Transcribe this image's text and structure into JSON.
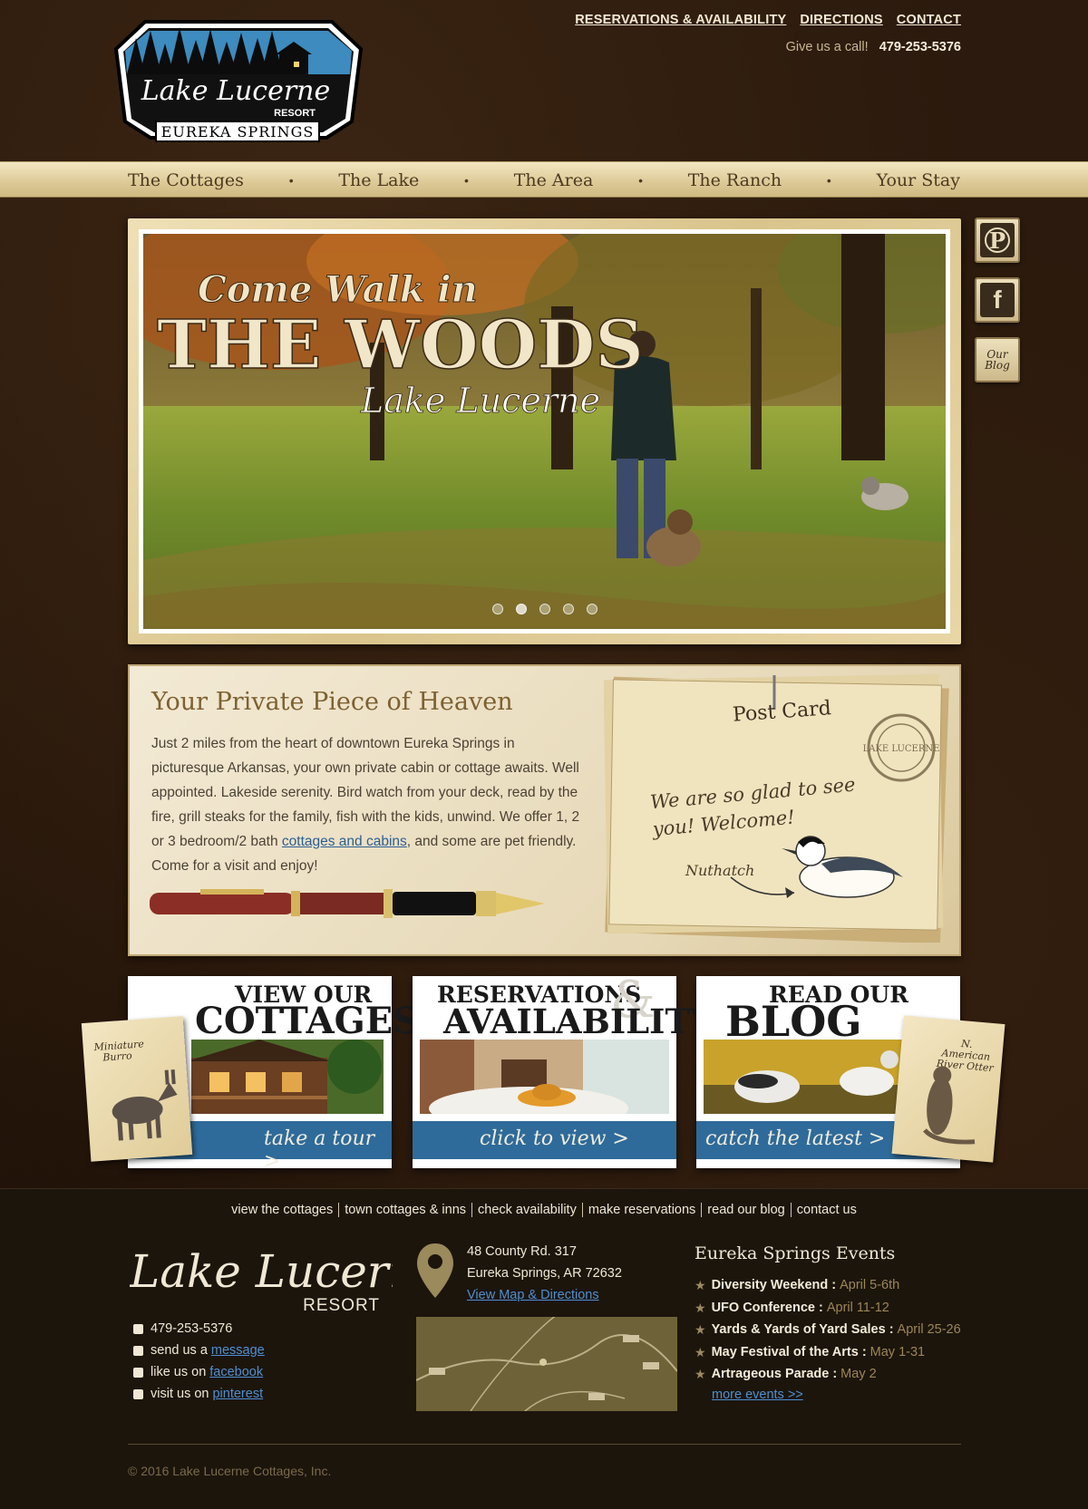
{
  "header": {
    "logo": {
      "line1": "Lake Lucerne",
      "line2": "RESORT",
      "line3": "EUREKA SPRINGS"
    },
    "top_links": [
      "RESERVATIONS & AVAILABILITY",
      "DIRECTIONS",
      "CONTACT"
    ],
    "call_label": "Give us a call!",
    "phone": "479-253-5376"
  },
  "nav": {
    "items": [
      "The Cottages",
      "The Lake",
      "The Area",
      "The Ranch",
      "Your Stay"
    ],
    "separator": "•"
  },
  "social": {
    "pinterest": "P",
    "facebook": "f",
    "blog": "Our Blog"
  },
  "hero": {
    "line1": "Come Walk in",
    "line2": "THE WOODS",
    "line3": "Lake Lucerne",
    "slides": 5,
    "active_slide": 1
  },
  "intro": {
    "heading": "Your Private Piece of Heaven",
    "body_before_link": "Just 2 miles from the heart of downtown Eureka Springs in picturesque Arkansas, your own private cabin or cottage awaits. Well appointed. Lakeside serenity. Bird watch from your deck, read by the fire, grill steaks for the family, fish with the kids, unwind. We offer 1, 2 or 3 bedroom/2 bath ",
    "link_text": "cottages and cabins",
    "body_after_link": ", and some are pet friendly. Come for a visit and enjoy!",
    "postcard": {
      "title": "Post Card",
      "greeting": "We are so glad to see you! Welcome!",
      "caption": "Nuthatch",
      "stamp": "LAKE LUCERNE"
    }
  },
  "cards": [
    {
      "title_top": "VIEW OUR",
      "title_big": "COTTAGES",
      "cta": "take a tour  >",
      "tag": "Miniature Burro"
    },
    {
      "title_top": "RESERVATIONS",
      "title_amp": "&",
      "title_big": "AVAILABILITY",
      "cta": "click to view  >"
    },
    {
      "title_top": "READ OUR",
      "title_big": "BLOG",
      "cta": "catch the latest  >",
      "tag": "N. American River Otter"
    }
  ],
  "footer": {
    "links": [
      "view the cottages",
      "town cottages & inns",
      "check availability",
      "make reservations",
      "read our blog",
      "contact us"
    ],
    "logo": {
      "line1": "Lake Lucerne",
      "line2": "RESORT"
    },
    "contact": {
      "phone": "479-253-5376",
      "message_prefix": "send us a",
      "message_link": "message",
      "facebook_prefix": "like us on",
      "facebook_link": "facebook",
      "pinterest_prefix": "visit us on",
      "pinterest_link": "pinterest"
    },
    "address": {
      "line1": "48 County Rd. 317",
      "line2": "Eureka Springs, AR  72632",
      "map_link": "View Map & Directions"
    },
    "events": {
      "heading": "Eureka Springs Events",
      "items": [
        {
          "name": "Diversity Weekend :",
          "date": "April 5-6th"
        },
        {
          "name": "UFO Conference :",
          "date": "April 11-12"
        },
        {
          "name": "Yards & Yards of Yard Sales :",
          "date": "April 25-26"
        },
        {
          "name": "May Festival of the Arts :",
          "date": "May 1-31"
        },
        {
          "name": "Artrageous Parade :",
          "date": "May 2"
        }
      ],
      "more": "more events >>"
    },
    "copyright": "© 2016 Lake Lucerne Cottages, Inc."
  }
}
